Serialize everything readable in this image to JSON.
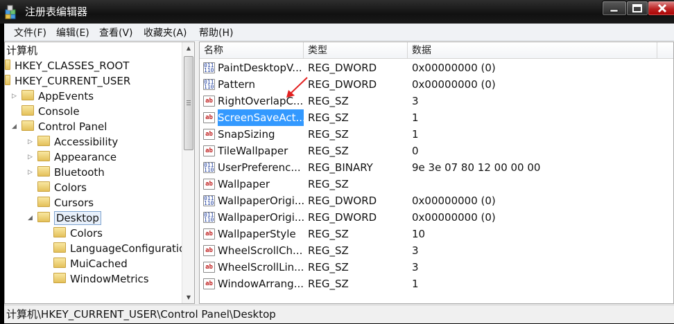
{
  "window": {
    "title": "注册表编辑器"
  },
  "menu": [
    "文件(F)",
    "编辑(E)",
    "查看(V)",
    "收藏夹(A)",
    "帮助(H)"
  ],
  "tree": [
    {
      "label": "计算机",
      "name": "tree-item-computer"
    },
    {
      "label": "HKEY_CLASSES_ROOT",
      "name": "tree-item-hkey-classes-root"
    },
    {
      "label": "HKEY_CURRENT_USER",
      "name": "tree-item-hkey-current-user"
    },
    {
      "label": "AppEvents",
      "name": "tree-item-appevents"
    },
    {
      "label": "Console",
      "name": "tree-item-console"
    },
    {
      "label": "Control Panel",
      "name": "tree-item-control-panel"
    },
    {
      "label": "Accessibility",
      "name": "tree-item-accessibility"
    },
    {
      "label": "Appearance",
      "name": "tree-item-appearance"
    },
    {
      "label": "Bluetooth",
      "name": "tree-item-bluetooth"
    },
    {
      "label": "Colors",
      "name": "tree-item-colors"
    },
    {
      "label": "Cursors",
      "name": "tree-item-cursors"
    },
    {
      "label": "Desktop",
      "name": "tree-item-desktop"
    },
    {
      "label": "Colors",
      "name": "tree-item-desktop-colors"
    },
    {
      "label": "LanguageConfiguratio",
      "name": "tree-item-languageconfiguration"
    },
    {
      "label": "MuiCached",
      "name": "tree-item-muicached"
    },
    {
      "label": "WindowMetrics",
      "name": "tree-item-windowmetrics"
    }
  ],
  "columns": {
    "name": "名称",
    "type": "类型",
    "data": "数据"
  },
  "values": [
    {
      "name": "PaintDesktopV...",
      "type": "REG_DWORD",
      "data": "0x00000000 (0)",
      "icon": "binary-value-icon"
    },
    {
      "name": "Pattern",
      "type": "REG_DWORD",
      "data": "0x00000000 (0)",
      "icon": "binary-value-icon"
    },
    {
      "name": "RightOverlapC...",
      "type": "REG_SZ",
      "data": "3",
      "icon": "string-value-icon"
    },
    {
      "name": "ScreenSaveAct...",
      "type": "REG_SZ",
      "data": "1",
      "icon": "string-value-icon"
    },
    {
      "name": "SnapSizing",
      "type": "REG_SZ",
      "data": "1",
      "icon": "string-value-icon"
    },
    {
      "name": "TileWallpaper",
      "type": "REG_SZ",
      "data": "0",
      "icon": "string-value-icon"
    },
    {
      "name": "UserPreferenc...",
      "type": "REG_BINARY",
      "data": "9e 3e 07 80 12 00 00 00",
      "icon": "binary-value-icon"
    },
    {
      "name": "Wallpaper",
      "type": "REG_SZ",
      "data": "",
      "icon": "string-value-icon"
    },
    {
      "name": "WallpaperOrigi...",
      "type": "REG_DWORD",
      "data": "0x00000000 (0)",
      "icon": "binary-value-icon"
    },
    {
      "name": "WallpaperOrigi...",
      "type": "REG_DWORD",
      "data": "0x00000000 (0)",
      "icon": "binary-value-icon"
    },
    {
      "name": "WallpaperStyle",
      "type": "REG_SZ",
      "data": "10",
      "icon": "string-value-icon"
    },
    {
      "name": "WheelScrollCh...",
      "type": "REG_SZ",
      "data": "3",
      "icon": "string-value-icon"
    },
    {
      "name": "WheelScrollLin...",
      "type": "REG_SZ",
      "data": "3",
      "icon": "string-value-icon"
    },
    {
      "name": "WindowArrang...",
      "type": "REG_SZ",
      "data": "1",
      "icon": "string-value-icon"
    }
  ],
  "selected_value_index": 3,
  "status": {
    "path": "计算机\\HKEY_CURRENT_USER\\Control Panel\\Desktop"
  },
  "colors": {
    "selection": "#3399ff",
    "annotation_arrow": "#e32020"
  }
}
